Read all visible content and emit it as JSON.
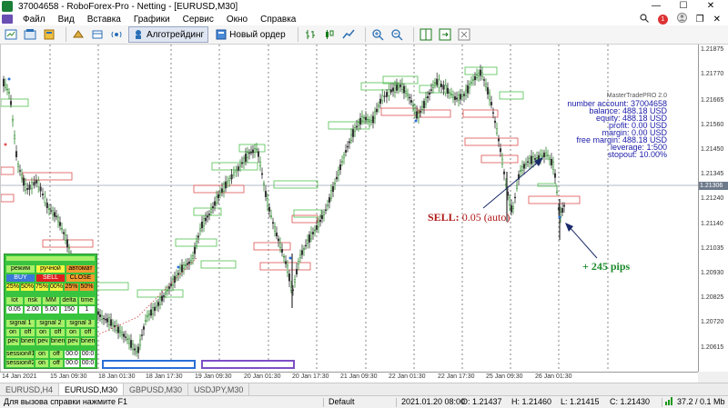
{
  "window": {
    "title": "37004658 - RoboForex-Pro - Netting - [EURUSD,M30]",
    "minimize": "—",
    "maximize": "☐",
    "close": "✕"
  },
  "menu": {
    "items": [
      "Файл",
      "Вид",
      "Вставка",
      "Графики",
      "Сервис",
      "Окно",
      "Справка"
    ],
    "badge": "1",
    "restore": "❐",
    "close": "✕"
  },
  "toolbar": {
    "algo_label": "Алготрейдинг",
    "new_order_label": "Новый ордер"
  },
  "info": {
    "header": "MasterTradePRO 2.0",
    "lines": [
      "number account: 37004658",
      "balance: 488.18 USD",
      "equity: 488.18 USD",
      "profit: 0.00 USD",
      "margin: 0.00 USD",
      "free margin: 488.18 USD",
      "leverage: 1:500",
      "stopout: 10.00%"
    ]
  },
  "price_axis": {
    "labels": [
      "1.21875",
      "1.21770",
      "1.21665",
      "1.21560",
      "1.21450",
      "1.21345",
      "1.21240",
      "1.21140",
      "1.21035",
      "1.20930",
      "1.20825",
      "1.20720",
      "1.20615"
    ],
    "current": "1.21306"
  },
  "time_axis": {
    "labels": [
      "14 Jan 2021",
      "15 Jan 09:30",
      "18 Jan 01:30",
      "18 Jan 17:30",
      "19 Jan 09:30",
      "20 Jan 01:30",
      "20 Jan 17:30",
      "21 Jan 09:30",
      "22 Jan 01:30",
      "22 Jan 17:30",
      "25 Jan 09:30",
      "26 Jan 01:30"
    ]
  },
  "annotations": {
    "sell_prefix": "SELL:",
    "sell_value": " 0.05 (auto)",
    "pips": "+ 245 pips"
  },
  "panel": {
    "mode": [
      "режим",
      "ручной",
      "автомат"
    ],
    "actions": [
      "BUY",
      "SELL",
      "CLOSE"
    ],
    "percents": [
      "25%",
      "50%",
      "75%",
      "00%",
      "25%",
      "50%"
    ],
    "params_head": [
      "lot",
      "risk",
      "MM",
      "delta",
      "time"
    ],
    "params_val": [
      "0.05",
      "2.00",
      "5.00",
      "150",
      "1"
    ],
    "signals": [
      "signal 1",
      "signal 2",
      "signal 3"
    ],
    "sig_row1": [
      "on",
      "off",
      "on",
      "off",
      "on",
      "off"
    ],
    "sig_row2": [
      "реч",
      "bnen",
      "реч",
      "bnen",
      "реч",
      "bnen"
    ],
    "sessions": [
      {
        "name": "session#1",
        "on": "on",
        "off": "off",
        "t1": "00:0",
        "t2": "00:0"
      },
      {
        "name": "session#2",
        "on": "on",
        "off": "off",
        "t1": "00:0",
        "t2": "00:0"
      }
    ]
  },
  "tabs": [
    "EURUSD,H4",
    "EURUSD,M30",
    "GBPUSD,M30",
    "USDJPY,M30"
  ],
  "status": {
    "help": "Для вызова справки нажмите F1",
    "profile": "Default",
    "datetime": "2021.01.20 08:00",
    "open": "O: 1.21437",
    "high": "H: 1.21460",
    "low": "L: 1.21415",
    "close": "C: 1.21430",
    "traffic": "37.2 / 0.1 Mb"
  },
  "colors": {
    "bull": "#2e8b2e",
    "bear": "#333333",
    "sell": "#b01818",
    "pips": "#1a8a2a",
    "info": "#1a1aa8"
  }
}
